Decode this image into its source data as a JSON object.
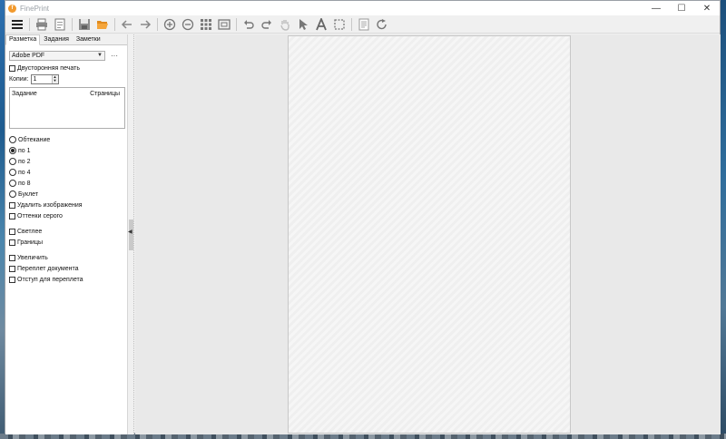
{
  "window": {
    "title": "FinePrint",
    "controls": {
      "minimize": "—",
      "maximize": "☐",
      "close": "✕"
    }
  },
  "toolbar": {
    "icons": [
      "menu-icon",
      "print-icon",
      "printer-setup-icon",
      "save-icon",
      "open-folder-icon",
      "back-arrow-icon",
      "forward-arrow-icon",
      "zoom-in-icon",
      "zoom-out-icon",
      "grid-icon",
      "fit-page-icon",
      "undo-icon",
      "redo-icon",
      "hand-icon",
      "pointer-icon",
      "text-icon",
      "select-rect-icon",
      "document-icon",
      "refresh-icon"
    ]
  },
  "tabs": [
    {
      "label": "Разметка",
      "active": true
    },
    {
      "label": "Задания",
      "active": false
    },
    {
      "label": "Заметки",
      "active": false
    }
  ],
  "printer": {
    "selected": "Adobe PDF",
    "more_label": "···"
  },
  "duplex": {
    "label": "Двусторонняя печать",
    "checked": false
  },
  "copies": {
    "label": "Копии:",
    "value": "1"
  },
  "jobs": {
    "col_job": "Задание",
    "col_pages": "Страницы"
  },
  "layout_options": [
    {
      "label": "Обтекание",
      "checked": false
    },
    {
      "label": "по 1",
      "checked": true
    },
    {
      "label": "по 2",
      "checked": false
    },
    {
      "label": "по 4",
      "checked": false
    },
    {
      "label": "по 8",
      "checked": false
    },
    {
      "label": "Буклет",
      "checked": false
    }
  ],
  "image_options": [
    {
      "label": "Удалить изображения",
      "checked": false
    },
    {
      "label": "Оттенки серого",
      "checked": false
    }
  ],
  "appearance_options": [
    {
      "label": "Светлее",
      "checked": false
    },
    {
      "label": "Границы",
      "checked": false
    }
  ],
  "binding_options": [
    {
      "label": "Увеличить",
      "checked": false
    },
    {
      "label": "Переплет документа",
      "checked": false
    },
    {
      "label": "Отступ для переплета",
      "checked": false
    }
  ]
}
